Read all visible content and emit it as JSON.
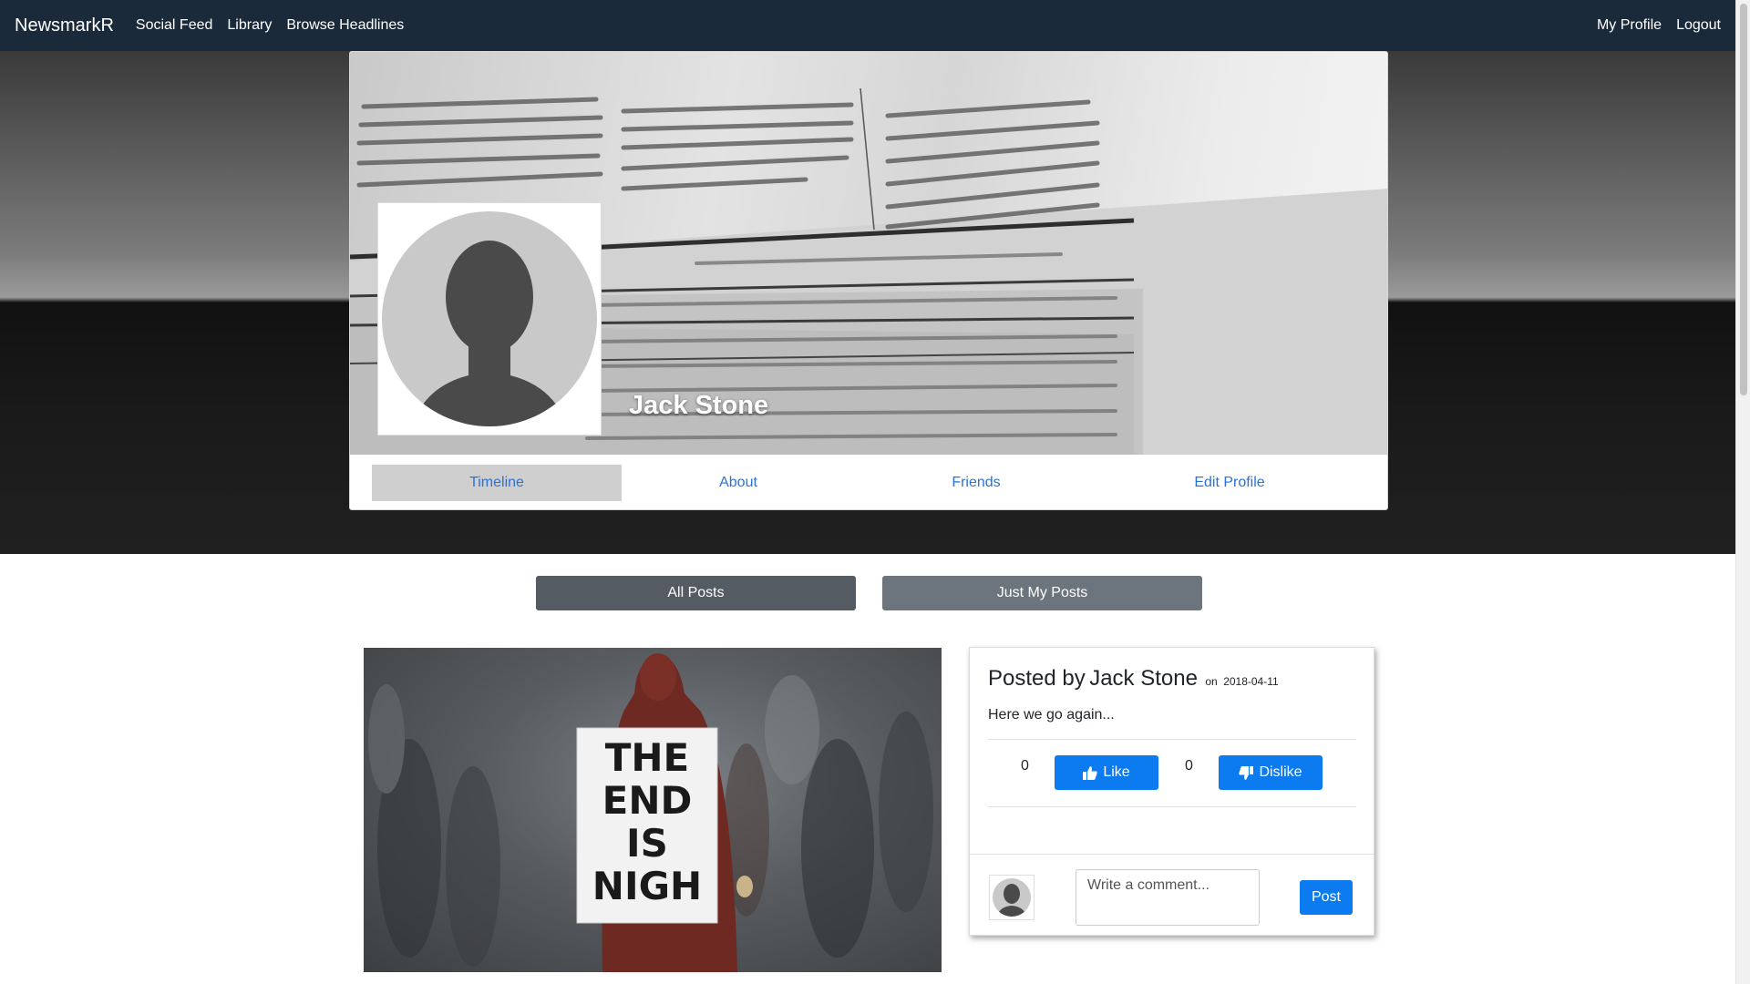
{
  "navbar": {
    "brand": "NewsmarkR",
    "links": [
      "Social Feed",
      "Library",
      "Browse Headlines"
    ],
    "right_links": [
      "My Profile",
      "Logout"
    ],
    "background_color": "#1b2a3a"
  },
  "profile": {
    "name": "Jack Stone",
    "avatar_icon": "user-silhouette-icon",
    "cover_image": "newspaper-stack-image",
    "tabs": [
      {
        "label": "Timeline",
        "active": true
      },
      {
        "label": "About",
        "active": false
      },
      {
        "label": "Friends",
        "active": false
      },
      {
        "label": "Edit Profile",
        "active": false
      }
    ]
  },
  "filters": {
    "all_posts": "All Posts",
    "just_my_posts": "Just My Posts"
  },
  "post": {
    "image": {
      "description_icon": "end-is-nigh-sign-image",
      "sign_lines": [
        "THE",
        "END",
        "IS",
        "NIGH"
      ]
    },
    "posted_by_prefix": "Posted by",
    "author": "Jack Stone",
    "date_prefix": "on",
    "date": "2018-04-11",
    "text": "Here we go again...",
    "likes": "0",
    "dislikes": "0",
    "like_label": "Like",
    "dislike_label": "Dislike",
    "like_icon": "thumbs-up-icon",
    "dislike_icon": "thumbs-down-icon",
    "comment_placeholder": "Write a comment...",
    "post_button": "Post"
  },
  "colors": {
    "primary": "#0c7bf0",
    "link": "#2a73d6",
    "active_tab": "#cfcfcf",
    "filter_dark": "#545b62",
    "filter_gray": "#6c757d"
  }
}
